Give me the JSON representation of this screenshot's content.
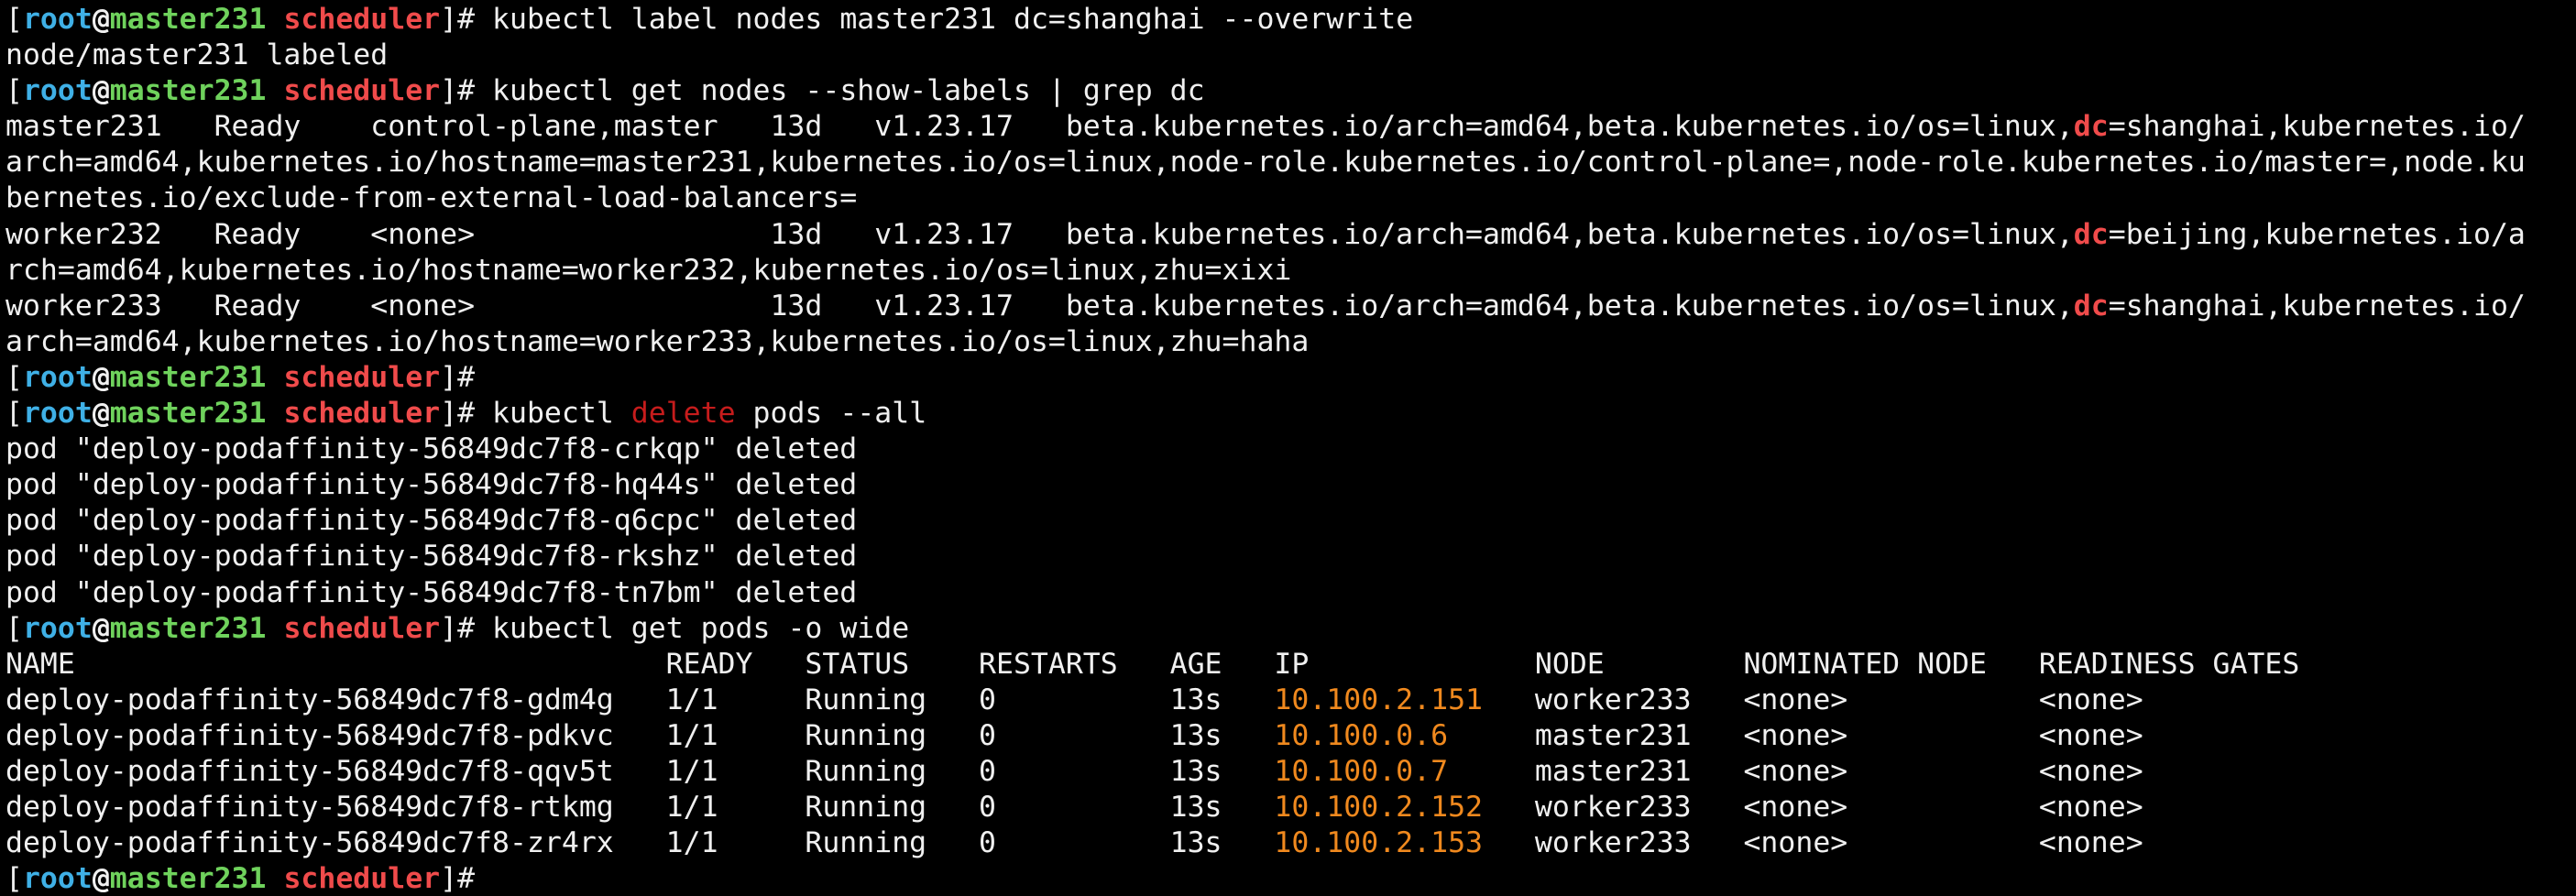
{
  "colors": {
    "background": "#000000",
    "text": "#f0f0f0",
    "prompt_user": "#3fb0e6",
    "prompt_host": "#6fd25c",
    "prompt_dir": "#f04b4b",
    "grep_match": "#f04b4b",
    "delete_keyword": "#c61c1c",
    "ip_address": "#f0891e"
  },
  "prompt": {
    "open_bracket": "[",
    "user": "root",
    "at": "@",
    "host": "master231",
    "space": " ",
    "dir": "scheduler",
    "close": "]#"
  },
  "lines": [
    [
      {
        "t": "[",
        "c": "bracket"
      },
      {
        "t": "root",
        "c": "user"
      },
      {
        "t": "@",
        "c": "at"
      },
      {
        "t": "master231",
        "c": "host"
      },
      {
        "t": " ",
        "c": "bracket"
      },
      {
        "t": "scheduler",
        "c": "dir"
      },
      {
        "t": "]#",
        "c": "bracket"
      },
      {
        "t": " kubectl label nodes master231 dc=shanghai --overwrite",
        "c": "cmd"
      }
    ],
    [
      {
        "t": "node/master231 labeled",
        "c": "out"
      }
    ],
    [
      {
        "t": "[",
        "c": "bracket"
      },
      {
        "t": "root",
        "c": "user"
      },
      {
        "t": "@",
        "c": "at"
      },
      {
        "t": "master231",
        "c": "host"
      },
      {
        "t": " ",
        "c": "bracket"
      },
      {
        "t": "scheduler",
        "c": "dir"
      },
      {
        "t": "]#",
        "c": "bracket"
      },
      {
        "t": " kubectl get nodes --show-labels | grep dc",
        "c": "cmd"
      }
    ],
    [
      {
        "t": "master231   Ready    control-plane,master   13d   v1.23.17   beta.kubernetes.io/arch=amd64,beta.kubernetes.io/os=linux,",
        "c": "out"
      },
      {
        "t": "dc",
        "c": "match"
      },
      {
        "t": "=shanghai,kubernetes.io/",
        "c": "out"
      }
    ],
    [
      {
        "t": "arch=amd64,kubernetes.io/hostname=master231,kubernetes.io/os=linux,node-role.kubernetes.io/control-plane=,node-role.kubernetes.io/master=,node.ku",
        "c": "out"
      }
    ],
    [
      {
        "t": "bernetes.io/exclude-from-external-load-balancers=",
        "c": "out"
      }
    ],
    [
      {
        "t": "worker232   Ready    <none>                 13d   v1.23.17   beta.kubernetes.io/arch=amd64,beta.kubernetes.io/os=linux,",
        "c": "out"
      },
      {
        "t": "dc",
        "c": "match"
      },
      {
        "t": "=beijing,kubernetes.io/a",
        "c": "out"
      }
    ],
    [
      {
        "t": "rch=amd64,kubernetes.io/hostname=worker232,kubernetes.io/os=linux,zhu=xixi",
        "c": "out"
      }
    ],
    [
      {
        "t": "worker233   Ready    <none>                 13d   v1.23.17   beta.kubernetes.io/arch=amd64,beta.kubernetes.io/os=linux,",
        "c": "out"
      },
      {
        "t": "dc",
        "c": "match"
      },
      {
        "t": "=shanghai,kubernetes.io/",
        "c": "out"
      }
    ],
    [
      {
        "t": "arch=amd64,kubernetes.io/hostname=worker233,kubernetes.io/os=linux,zhu=haha",
        "c": "out"
      }
    ],
    [
      {
        "t": "[",
        "c": "bracket"
      },
      {
        "t": "root",
        "c": "user"
      },
      {
        "t": "@",
        "c": "at"
      },
      {
        "t": "master231",
        "c": "host"
      },
      {
        "t": " ",
        "c": "bracket"
      },
      {
        "t": "scheduler",
        "c": "dir"
      },
      {
        "t": "]#",
        "c": "bracket"
      }
    ],
    [
      {
        "t": "[",
        "c": "bracket"
      },
      {
        "t": "root",
        "c": "user"
      },
      {
        "t": "@",
        "c": "at"
      },
      {
        "t": "master231",
        "c": "host"
      },
      {
        "t": " ",
        "c": "bracket"
      },
      {
        "t": "scheduler",
        "c": "dir"
      },
      {
        "t": "]#",
        "c": "bracket"
      },
      {
        "t": " kubectl ",
        "c": "cmd"
      },
      {
        "t": "delete",
        "c": "kw-red"
      },
      {
        "t": " pods --all",
        "c": "cmd"
      }
    ],
    [
      {
        "t": "pod \"deploy-podaffinity-56849dc7f8-crkqp\" deleted",
        "c": "out"
      }
    ],
    [
      {
        "t": "pod \"deploy-podaffinity-56849dc7f8-hq44s\" deleted",
        "c": "out"
      }
    ],
    [
      {
        "t": "pod \"deploy-podaffinity-56849dc7f8-q6cpc\" deleted",
        "c": "out"
      }
    ],
    [
      {
        "t": "pod \"deploy-podaffinity-56849dc7f8-rkshz\" deleted",
        "c": "out"
      }
    ],
    [
      {
        "t": "pod \"deploy-podaffinity-56849dc7f8-tn7bm\" deleted",
        "c": "out"
      }
    ],
    [
      {
        "t": "[",
        "c": "bracket"
      },
      {
        "t": "root",
        "c": "user"
      },
      {
        "t": "@",
        "c": "at"
      },
      {
        "t": "master231",
        "c": "host"
      },
      {
        "t": " ",
        "c": "bracket"
      },
      {
        "t": "scheduler",
        "c": "dir"
      },
      {
        "t": "]#",
        "c": "bracket"
      },
      {
        "t": " kubectl get pods -o wide",
        "c": "cmd"
      }
    ],
    [
      {
        "t": "NAME                                  READY   STATUS    RESTARTS   AGE   IP             NODE        NOMINATED NODE   READINESS GATES",
        "c": "out"
      }
    ],
    [
      {
        "t": "deploy-podaffinity-56849dc7f8-gdm4g   1/1     Running   0          13s   ",
        "c": "out"
      },
      {
        "t": "10.100.2.151",
        "c": "ip"
      },
      {
        "t": "   worker233   <none>           <none>",
        "c": "out"
      }
    ],
    [
      {
        "t": "deploy-podaffinity-56849dc7f8-pdkvc   1/1     Running   0          13s   ",
        "c": "out"
      },
      {
        "t": "10.100.0.6",
        "c": "ip"
      },
      {
        "t": "     master231   <none>           <none>",
        "c": "out"
      }
    ],
    [
      {
        "t": "deploy-podaffinity-56849dc7f8-qqv5t   1/1     Running   0          13s   ",
        "c": "out"
      },
      {
        "t": "10.100.0.7",
        "c": "ip"
      },
      {
        "t": "     master231   <none>           <none>",
        "c": "out"
      }
    ],
    [
      {
        "t": "deploy-podaffinity-56849dc7f8-rtkmg   1/1     Running   0          13s   ",
        "c": "out"
      },
      {
        "t": "10.100.2.152",
        "c": "ip"
      },
      {
        "t": "   worker233   <none>           <none>",
        "c": "out"
      }
    ],
    [
      {
        "t": "deploy-podaffinity-56849dc7f8-zr4rx   1/1     Running   0          13s   ",
        "c": "out"
      },
      {
        "t": "10.100.2.153",
        "c": "ip"
      },
      {
        "t": "   worker233   <none>           <none>",
        "c": "out"
      }
    ],
    [
      {
        "t": "[",
        "c": "bracket"
      },
      {
        "t": "root",
        "c": "user"
      },
      {
        "t": "@",
        "c": "at"
      },
      {
        "t": "master231",
        "c": "host"
      },
      {
        "t": " ",
        "c": "bracket"
      },
      {
        "t": "scheduler",
        "c": "dir"
      },
      {
        "t": "]#",
        "c": "bracket"
      }
    ]
  ]
}
